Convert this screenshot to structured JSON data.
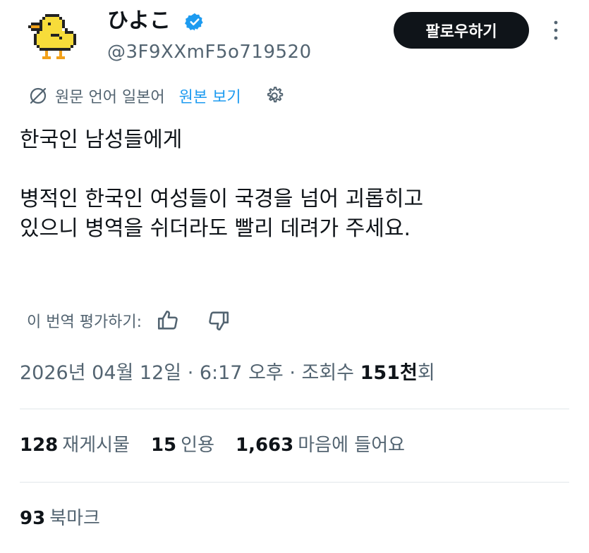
{
  "author": {
    "display_name": "ひよこ",
    "handle": "@3F9XXmF5o719520",
    "verified": true
  },
  "follow_button": {
    "label": "팔로우하기"
  },
  "translation": {
    "original_language": "원문 언어 일본어",
    "show_original_label": "원본 보기"
  },
  "tweet": {
    "text": "한국인 남성들에게\n\n병적인 한국인 여성들이 국경을 넘어 괴롭히고\n있으니 병역을 쉬더라도 빨리 데려가 주세요."
  },
  "rate": {
    "label": "이 번역 평가하기:"
  },
  "meta": {
    "date_time": "2026년 04월 12일 · 6:17 오후 · 조회수 ",
    "views": "151천",
    "views_suffix": "회"
  },
  "stats": {
    "reposts": {
      "count": "128",
      "label": "재게시물"
    },
    "quotes": {
      "count": "15",
      "label": "인용"
    },
    "likes": {
      "count": "1,663",
      "label": "마음에 들어요"
    },
    "bookmarks": {
      "count": "93",
      "label": "북마크"
    }
  },
  "colors": {
    "accent": "#1d9bf0",
    "text_primary": "#0f1419",
    "text_secondary": "#536471",
    "avatar_yellow": "#f7dc3a"
  },
  "icons": [
    "chick-avatar",
    "verified-badge-icon",
    "more-icon",
    "globe-icon",
    "gear-icon",
    "thumbs-up-icon",
    "thumbs-down-icon"
  ]
}
